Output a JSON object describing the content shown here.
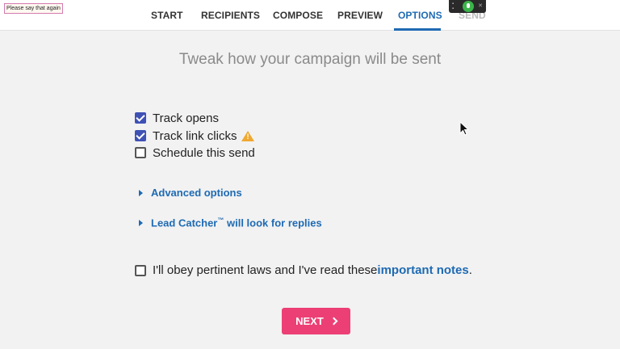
{
  "voice_tooltip": "Please say that again",
  "tabs": [
    {
      "label": "START"
    },
    {
      "label": "RECIPIENTS"
    },
    {
      "label": "COMPOSE"
    },
    {
      "label": "PREVIEW"
    },
    {
      "label": "OPTIONS",
      "active": true
    },
    {
      "label": "SEND"
    }
  ],
  "headline": "Tweak how your campaign will be sent",
  "options": {
    "track_opens": {
      "label": "Track opens",
      "checked": true
    },
    "track_link_clicks": {
      "label": "Track link clicks",
      "checked": true,
      "icon": "warning-icon"
    },
    "schedule_send": {
      "label": "Schedule this send",
      "checked": false
    }
  },
  "advanced_options": {
    "label": "Advanced options"
  },
  "lead_catcher": {
    "label_prefix": "Lead Catcher",
    "trademark": "™",
    "label_suffix": " will look for replies"
  },
  "agreement": {
    "text": "I'll obey pertinent laws and I've read these ",
    "link": "important notes",
    "end": ".",
    "checked": false
  },
  "next_button": {
    "label": "NEXT"
  },
  "colors": {
    "accent_blue": "#1e6ab3",
    "checkbox_blue": "#3f51b5",
    "next_pink": "#ec3f75"
  }
}
